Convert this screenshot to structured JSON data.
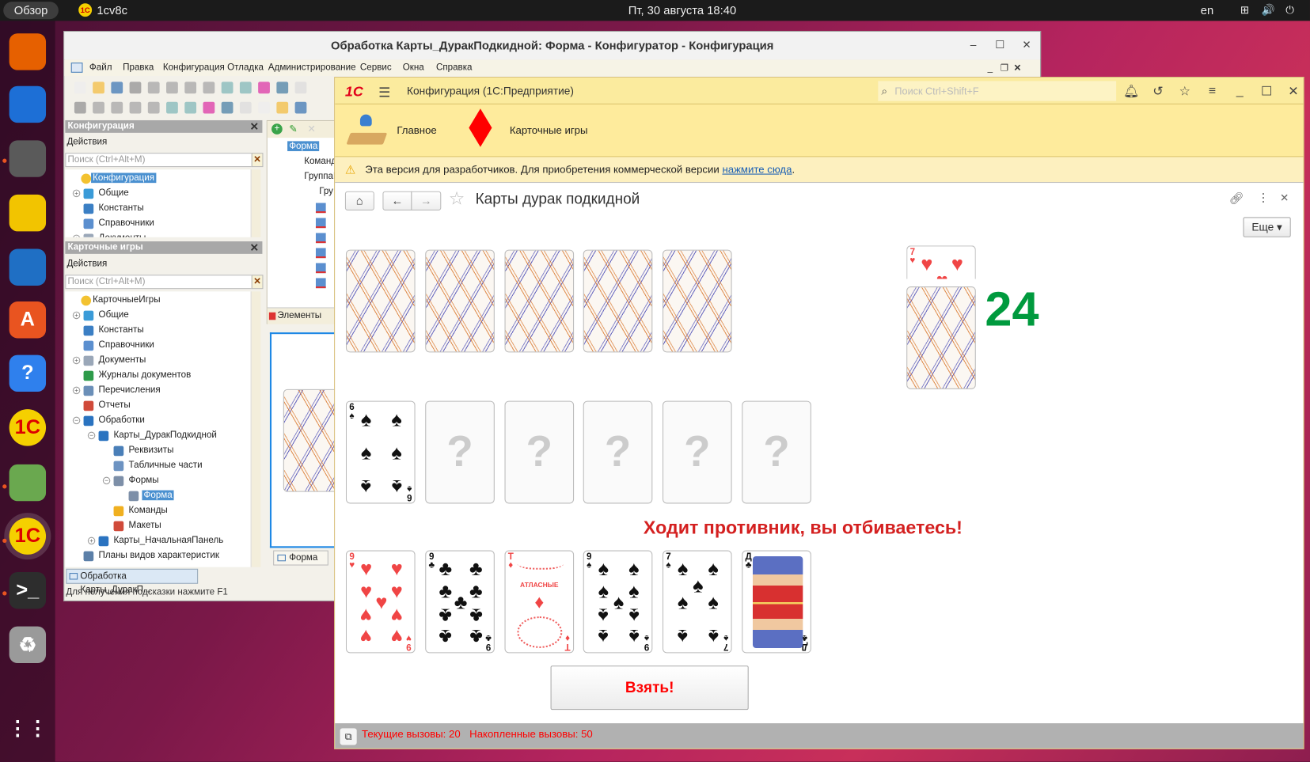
{
  "topbar": {
    "overview": "Обзор",
    "app": "1cv8c",
    "clock": "Пт, 30 августа  18:40",
    "lang": "en"
  },
  "dock": [
    "firefox-icon",
    "thunderbird-icon",
    "files-icon",
    "rhythmbox-icon",
    "writer-icon",
    "app-center-icon",
    "help-icon",
    "1c-icon",
    "geogebra-icon",
    "1c-running-icon",
    "terminal-icon",
    "trash-icon",
    "show-apps-icon"
  ],
  "configurator": {
    "title": "Обработка Карты_ДуракПодкидной: Форма - Конфигуратор - Конфигурация",
    "menu": [
      "Файл",
      "Правка",
      "Конфигурация",
      "Отладка",
      "Администрирование",
      "Сервис",
      "Окна",
      "Справка"
    ],
    "panel1": {
      "title": "Конфигурация",
      "actions": "Действия",
      "search_placeholder": "Поиск (Ctrl+Alt+M)",
      "tree": [
        {
          "label": "Конфигурация",
          "level": 0,
          "root": true,
          "selected": true,
          "icon": "#f3c230"
        },
        {
          "label": "Общие",
          "level": 0,
          "exp": "+",
          "icon": "#3a9bd8"
        },
        {
          "label": "Константы",
          "level": 0,
          "icon": "#3b7fc4"
        },
        {
          "label": "Справочники",
          "level": 0,
          "icon": "#5b8fcf"
        },
        {
          "label": "Документы",
          "level": 0,
          "exp": "+",
          "icon": "#9aa7b8"
        }
      ]
    },
    "panel2": {
      "title": "Карточные игры",
      "actions": "Действия",
      "search_placeholder": "Поиск (Ctrl+Alt+M)",
      "tree": [
        {
          "label": "КарточныеИгры",
          "level": 0,
          "root": true,
          "icon": "#f3c230"
        },
        {
          "label": "Общие",
          "level": 0,
          "exp": "+",
          "icon": "#3a9bd8"
        },
        {
          "label": "Константы",
          "level": 0,
          "icon": "#3b7fc4"
        },
        {
          "label": "Справочники",
          "level": 0,
          "icon": "#5b8fcf"
        },
        {
          "label": "Документы",
          "level": 0,
          "exp": "+",
          "icon": "#9aa7b8"
        },
        {
          "label": "Журналы документов",
          "level": 0,
          "icon": "#2e9b4a"
        },
        {
          "label": "Перечисления",
          "level": 0,
          "exp": "+",
          "icon": "#6b8fb8"
        },
        {
          "label": "Отчеты",
          "level": 0,
          "icon": "#d04a3a"
        },
        {
          "label": "Обработки",
          "level": 0,
          "exp": "−",
          "icon": "#2a73c0"
        },
        {
          "label": "Карты_ДуракПодкидной",
          "level": 1,
          "exp": "−",
          "icon": "#2a73c0"
        },
        {
          "label": "Реквизиты",
          "level": 2,
          "icon": "#4a7fb8"
        },
        {
          "label": "Табличные части",
          "level": 2,
          "icon": "#6d93c2"
        },
        {
          "label": "Формы",
          "level": 2,
          "exp": "−",
          "icon": "#7d8fa8"
        },
        {
          "label": "Форма",
          "level": 3,
          "selected": true,
          "icon": "#7d8fa8"
        },
        {
          "label": "Команды",
          "level": 2,
          "icon": "#f0b020"
        },
        {
          "label": "Макеты",
          "level": 2,
          "icon": "#d04a3a"
        },
        {
          "label": "Карты_НачальнаяПанель",
          "level": 1,
          "exp": "+",
          "icon": "#2a73c0"
        },
        {
          "label": "Планы видов характеристик",
          "level": 0,
          "icon": "#5b7fa8"
        }
      ]
    },
    "form_tree": [
      {
        "label": "Форма",
        "selected": true
      },
      {
        "label": "Команд"
      },
      {
        "label": "ГруппаГ"
      },
      {
        "label": "Гру"
      }
    ],
    "elements_tab": "Элементы",
    "form_tab": "Форма",
    "taskbar_item": "Обработка Карты_ДуракП...",
    "status": "Для получения подсказки нажмите F1"
  },
  "enterprise": {
    "logo": "1С",
    "title": "Конфигурация  (1С:Предприятие)",
    "search_placeholder": "Поиск Ctrl+Shift+F",
    "sections": [
      {
        "label": "Главное",
        "icon": "lamp-icon"
      },
      {
        "label": "Карточные игры",
        "icon": "diamond-icon"
      }
    ],
    "warning": {
      "text": "Эта версия для разработчиков. Для приобретения коммерческой версии ",
      "link": "нажмите сюда",
      "tail": "."
    },
    "form_title": "Карты дурак подкидной",
    "more_button": "Еще",
    "status": {
      "current": "Текущие вызовы: 20",
      "accumulated": "Накопленные вызовы: 50"
    }
  },
  "game": {
    "opponent_cards": 5,
    "table": [
      {
        "rank": "6",
        "suit": "♠",
        "color": "black"
      }
    ],
    "table_placeholders": 5,
    "placeholder": "?",
    "message": "Ходит противник, вы отбиваетесь!",
    "hand": [
      {
        "rank": "9",
        "suit": "♥",
        "color": "red"
      },
      {
        "rank": "9",
        "suit": "♣",
        "color": "black"
      },
      {
        "rank": "Т",
        "suit": "♦",
        "color": "red",
        "caption": "АТЛАСНЫЕ"
      },
      {
        "rank": "9",
        "suit": "♠",
        "color": "black"
      },
      {
        "rank": "7",
        "suit": "♠",
        "color": "black"
      },
      {
        "rank": "Д",
        "suit": "♣",
        "color": "black"
      }
    ],
    "trump": {
      "rank": "7",
      "suit": "♥",
      "color": "red"
    },
    "deck_count": "24",
    "take_button": "Взять!",
    "colors": {
      "deck_count": "#009a3e",
      "message": "#d42020",
      "take": "#ff0000"
    }
  }
}
